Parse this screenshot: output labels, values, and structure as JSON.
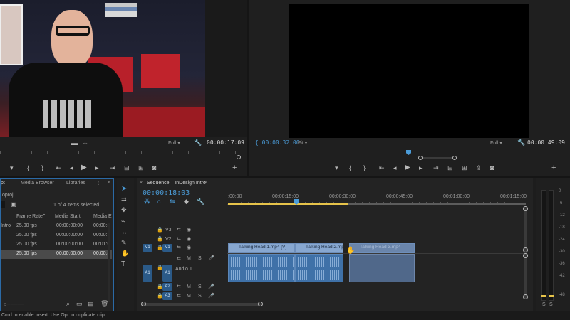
{
  "source_monitor": {
    "zoom": "Full",
    "timecode": "00:00:17:09"
  },
  "program_monitor": {
    "timecode_in": "{ 00:00:32:00",
    "fit": "Fit",
    "zoom": "Full",
    "timecode_out": "00:00:49:09"
  },
  "project_panel": {
    "tabs": [
      "pt",
      "Media Browser",
      "Libraries"
    ],
    "project_file": "oproj",
    "items_selected": "1 of 4 items selected",
    "columns": [
      "Frame Rate",
      "Media Start",
      "Media E"
    ],
    "rows": [
      {
        "name": "Intro",
        "fps": "25.00 fps",
        "start": "00:00:00:00",
        "end": "00:00:3"
      },
      {
        "name": "",
        "fps": "25.00 fps",
        "start": "00:00:00:00",
        "end": "00:00:4"
      },
      {
        "name": "",
        "fps": "25.00 fps",
        "start": "00:00:00:00",
        "end": "00:01:0"
      },
      {
        "name": "",
        "fps": "25.00 fps",
        "start": "00:00:00:00",
        "end": "00:00:3"
      }
    ]
  },
  "timeline": {
    "tab_title": "Sequence – InDesign Intro",
    "playhead_timecode": "00:00:18:03",
    "ruler": [
      ":00:00",
      "00:00:15:00",
      "00:00:30:00",
      "00:00:45:00",
      "00:01:00:00",
      "00:01:15:00"
    ],
    "tracks": {
      "v3": "V3",
      "v2": "V2",
      "v1_src": "V1",
      "v1": "V1",
      "a1_src": "A1",
      "a1": "A1",
      "audio_name": "Audio 1",
      "a2": "A2",
      "a3": "A3",
      "m": "M",
      "s": "S"
    },
    "clips": [
      {
        "name": "Talking Head 1.mp4 [V]"
      },
      {
        "name": "Talking Head 2.mp4"
      },
      {
        "name": "Talking Head 3.mp4"
      }
    ]
  },
  "audio_meter": {
    "scale": [
      "0",
      "-6",
      "-12",
      "-18",
      "-24",
      "-30",
      "-36",
      "-42",
      "-48"
    ],
    "solo_left": "S",
    "solo_right": "S"
  },
  "status_bar": {
    "message": "Cmd to enable Insert. Use Opt to duplicate clip."
  },
  "colors": {
    "accent": "#4b9cd8",
    "clip_video": "#87a7d0",
    "clip_audio": "#3f71a8",
    "work_area": "#e6c34a"
  }
}
